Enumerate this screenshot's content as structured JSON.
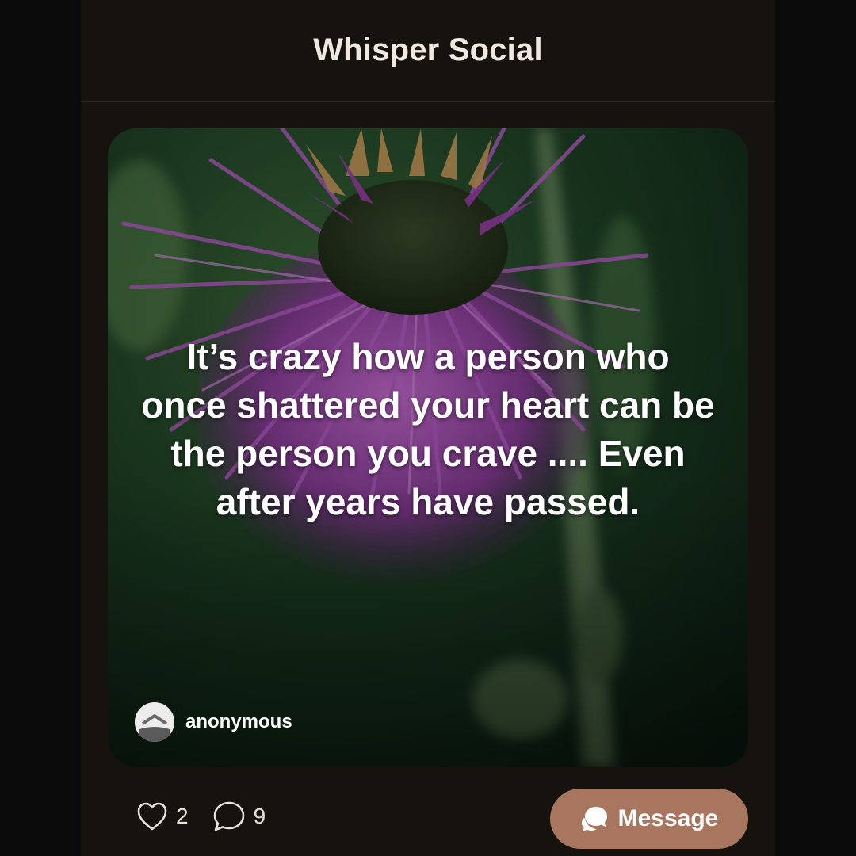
{
  "app": {
    "title": "Whisper Social"
  },
  "post": {
    "text": "It’s crazy how a person who once shattered your heart can be the person you crave .... Even after years have passed.",
    "author": "anonymous",
    "likes": "2",
    "comments": "9"
  },
  "actions": {
    "message_label": "Message"
  },
  "icons": {
    "like": "heart-icon",
    "comment": "comment-bubble-icon",
    "message": "chat-bubbles-icon",
    "avatar": "anonymous-avatar-icon"
  },
  "colors": {
    "background": "#16130f",
    "accent": "#a8765f",
    "text": "#efe9e2"
  }
}
